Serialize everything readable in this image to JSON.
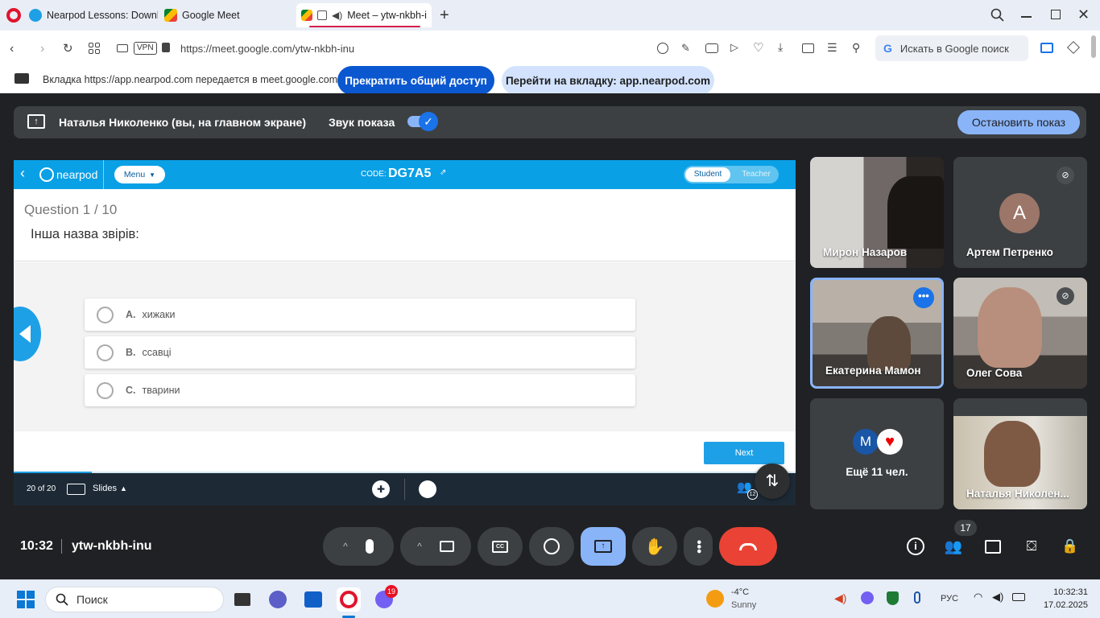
{
  "browser": {
    "tabs": [
      {
        "title": "Nearpod Lessons: Downlo"
      },
      {
        "title": "Google Meet"
      },
      {
        "title": "Meet – ytw-nkbh-i"
      }
    ],
    "url": "https://meet.google.com/ytw-nkbh-inu",
    "vpn_label": "VPN",
    "search_placeholder": "Искать в Google поиск"
  },
  "notification": {
    "message": "Вкладка https://app.nearpod.com передается в meet.google.com",
    "stop_sharing_label": "Прекратить общий доступ",
    "go_to_tab_label": "Перейти на вкладку: app.nearpod.com"
  },
  "share_banner": {
    "presenter": "Наталья Николенко (вы, на главном экране)",
    "sound_label": "Звук показа",
    "stop_label": "Остановить показ"
  },
  "nearpod": {
    "logo_text": "nearpod",
    "menu_label": "Menu",
    "code_label": "CODE:",
    "code_value": "DG7A5",
    "student_label": "Student",
    "teacher_label": "Teacher",
    "question_number": "Question 1 / 10",
    "question_text": "Інша назва звірів:",
    "choices": [
      {
        "letter": "A.",
        "text": "хижаки"
      },
      {
        "letter": "B.",
        "text": "ссавці"
      },
      {
        "letter": "C.",
        "text": "тварини"
      }
    ],
    "next_label": "Next",
    "slide_counter": "20 of 20",
    "slides_label": "Slides",
    "participants_count": "12",
    "progress": 0.1
  },
  "participants": {
    "tile1_name": "Мирон Назаров",
    "tile2_name": "Артем Петренко",
    "tile2_initial": "А",
    "tile3_name": "Екатерина Мамон",
    "tile4_name": "Олег Сова",
    "more_initial": "M",
    "more_label": "Ещё 11 чел.",
    "tile6_name": "Наталья Николен..."
  },
  "meet_controls": {
    "time": "10:32",
    "meeting_code": "ytw-nkbh-inu",
    "people_count": "17"
  },
  "taskbar": {
    "search_label": "Поиск",
    "viber_badge": "19",
    "weather_temp": "-4°C",
    "weather_desc": "Sunny",
    "language": "РУС",
    "clock_time": "10:32:31",
    "clock_date": "17.02.2025"
  },
  "colors": {
    "meet_bg": "#202124",
    "nearpod_blue": "#0aa0e6",
    "end_call_red": "#ea4335",
    "active_blue": "#8ab4f8"
  }
}
